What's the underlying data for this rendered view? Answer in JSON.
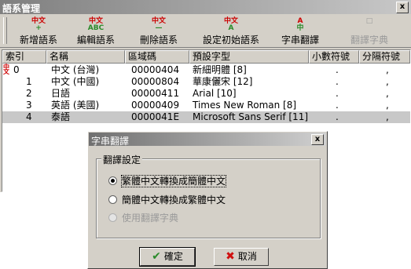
{
  "window": {
    "title": "語系管理",
    "close": "x"
  },
  "toolbar": [
    {
      "label": "新增語系",
      "icon_top": "中文",
      "icon_bottom": "+",
      "disabled": false
    },
    {
      "label": "編輯語系",
      "icon_top": "中文",
      "icon_bottom": "ABC",
      "disabled": false
    },
    {
      "label": "刪除語系",
      "icon_top": "中文",
      "icon_bottom": "—",
      "disabled": false
    },
    {
      "label": "設定初始語系",
      "icon_top": "中文",
      "icon_bottom": "A",
      "disabled": false
    },
    {
      "label": "字串翻譯",
      "icon_top": "A",
      "icon_bottom": "中",
      "disabled": false
    },
    {
      "label": "翻譯字典",
      "icon_top": "□",
      "icon_bottom": "",
      "disabled": true
    }
  ],
  "columns": [
    "索引",
    "名稱",
    "區域碼",
    "預設字型",
    "小數符號",
    "分隔符號"
  ],
  "rows": [
    {
      "index": "0",
      "name": "中文 (台灣)",
      "code": "00000404",
      "font": "新細明體 [8]",
      "decimal": ".",
      "sep": ","
    },
    {
      "index": "1",
      "name": "中文 (中國)",
      "code": "00000804",
      "font": "華康儷宋 [12]",
      "decimal": ".",
      "sep": ","
    },
    {
      "index": "2",
      "name": "日語",
      "code": "00000411",
      "font": "Arial [10]",
      "decimal": ".",
      "sep": ","
    },
    {
      "index": "3",
      "name": "英語 (美國)",
      "code": "00000409",
      "font": "Times New Roman [8]",
      "decimal": ".",
      "sep": ","
    },
    {
      "index": "4",
      "name": "泰語",
      "code": "0000041E",
      "font": "Microsoft Sans Serif [11]",
      "decimal": ".",
      "sep": ","
    }
  ],
  "selected_row": 4,
  "dialog": {
    "title": "字串翻譯",
    "close": "x",
    "group_label": "翻譯設定",
    "options": [
      {
        "label": "繁體中文轉換成簡體中文",
        "checked": true,
        "disabled": false
      },
      {
        "label": "簡體中文轉換成繁體中文",
        "checked": false,
        "disabled": false
      },
      {
        "label": "使用翻譯字典",
        "checked": false,
        "disabled": true
      }
    ],
    "ok": "確定",
    "cancel": "取消",
    "ok_icon": "✔",
    "cancel_icon": "✖"
  }
}
